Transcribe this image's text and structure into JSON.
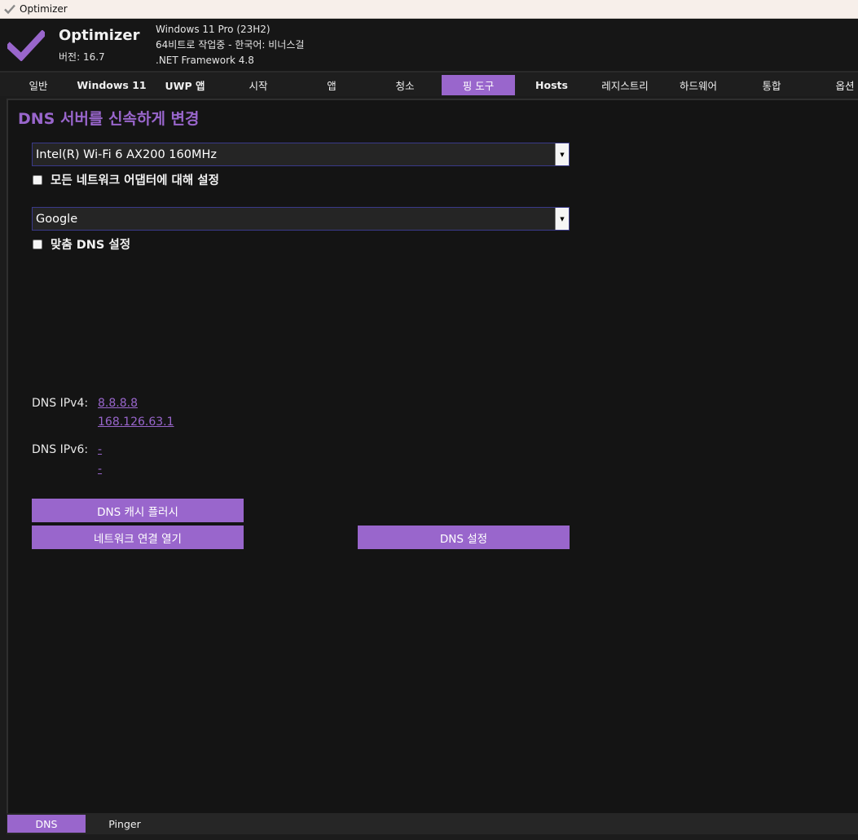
{
  "window": {
    "title": "Optimizer",
    "icon": "checkmark-icon"
  },
  "header": {
    "app_name": "Optimizer",
    "version": "버전: 16.7",
    "sysinfo": {
      "os": "Windows 11 Pro (23H2)",
      "arch": "64비트로 작업중 - 한국어: 비너스걸",
      "framework": ".NET Framework 4.8"
    },
    "accent": "#9966cc"
  },
  "tabs": [
    {
      "label": "일반",
      "active": false
    },
    {
      "label": "Windows 11",
      "active": false
    },
    {
      "label": "UWP 앱",
      "active": false
    },
    {
      "label": "시작",
      "active": false
    },
    {
      "label": "앱",
      "active": false
    },
    {
      "label": "청소",
      "active": false
    },
    {
      "label": "핑 도구",
      "active": true
    },
    {
      "label": "Hosts",
      "active": false
    },
    {
      "label": "레지스트리",
      "active": false
    },
    {
      "label": "하드웨어",
      "active": false
    },
    {
      "label": "통합",
      "active": false
    },
    {
      "label": "옵션",
      "active": false
    }
  ],
  "dns": {
    "title": "DNS 서버를 신속하게 변경",
    "adapter_select": "Intel(R) Wi-Fi 6 AX200 160MHz",
    "all_adapters_label": "모든 네트워크 어댑터에 대해 설정",
    "all_adapters_checked": false,
    "provider_select": "Google",
    "custom_dns_label": "맞춤 DNS 설정",
    "custom_dns_checked": false,
    "ipv4_label": "DNS IPv4:",
    "ipv4_primary": "8.8.8.8",
    "ipv4_secondary": "168.126.63.1",
    "ipv6_label": "DNS IPv6:",
    "ipv6_primary": "-",
    "ipv6_secondary": "-",
    "flush_button": "DNS 캐시 플러시",
    "network_button": "네트워크 연결 열기",
    "set_button": "DNS 설정"
  },
  "bottom_tabs": [
    {
      "label": "DNS",
      "active": true
    },
    {
      "label": "Pinger",
      "active": false
    }
  ]
}
